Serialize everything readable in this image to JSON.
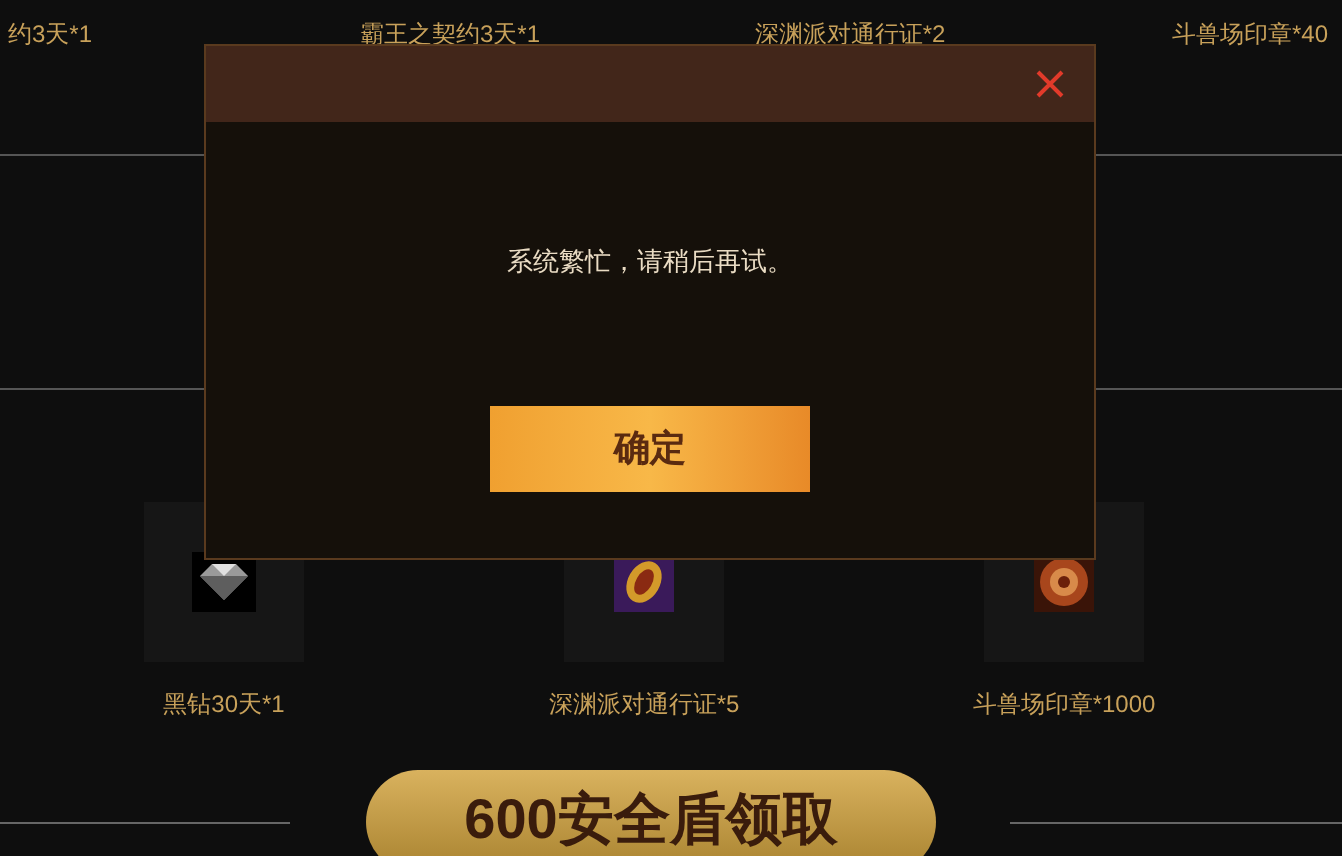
{
  "top_rewards": [
    "约3天*1",
    "霸王之契约3天*1",
    "深渊派对通行证*2",
    "斗兽场印章*40"
  ],
  "rewards": [
    {
      "kind": "diamond",
      "label": "黑钻30天*1"
    },
    {
      "kind": "gem",
      "label": "深渊派对通行证*5"
    },
    {
      "kind": "seal",
      "label": "斗兽场印章*1000"
    }
  ],
  "claim_button": "600安全盾领取",
  "dialog": {
    "message": "系统繁忙，请稍后再试。",
    "confirm": "确定"
  }
}
